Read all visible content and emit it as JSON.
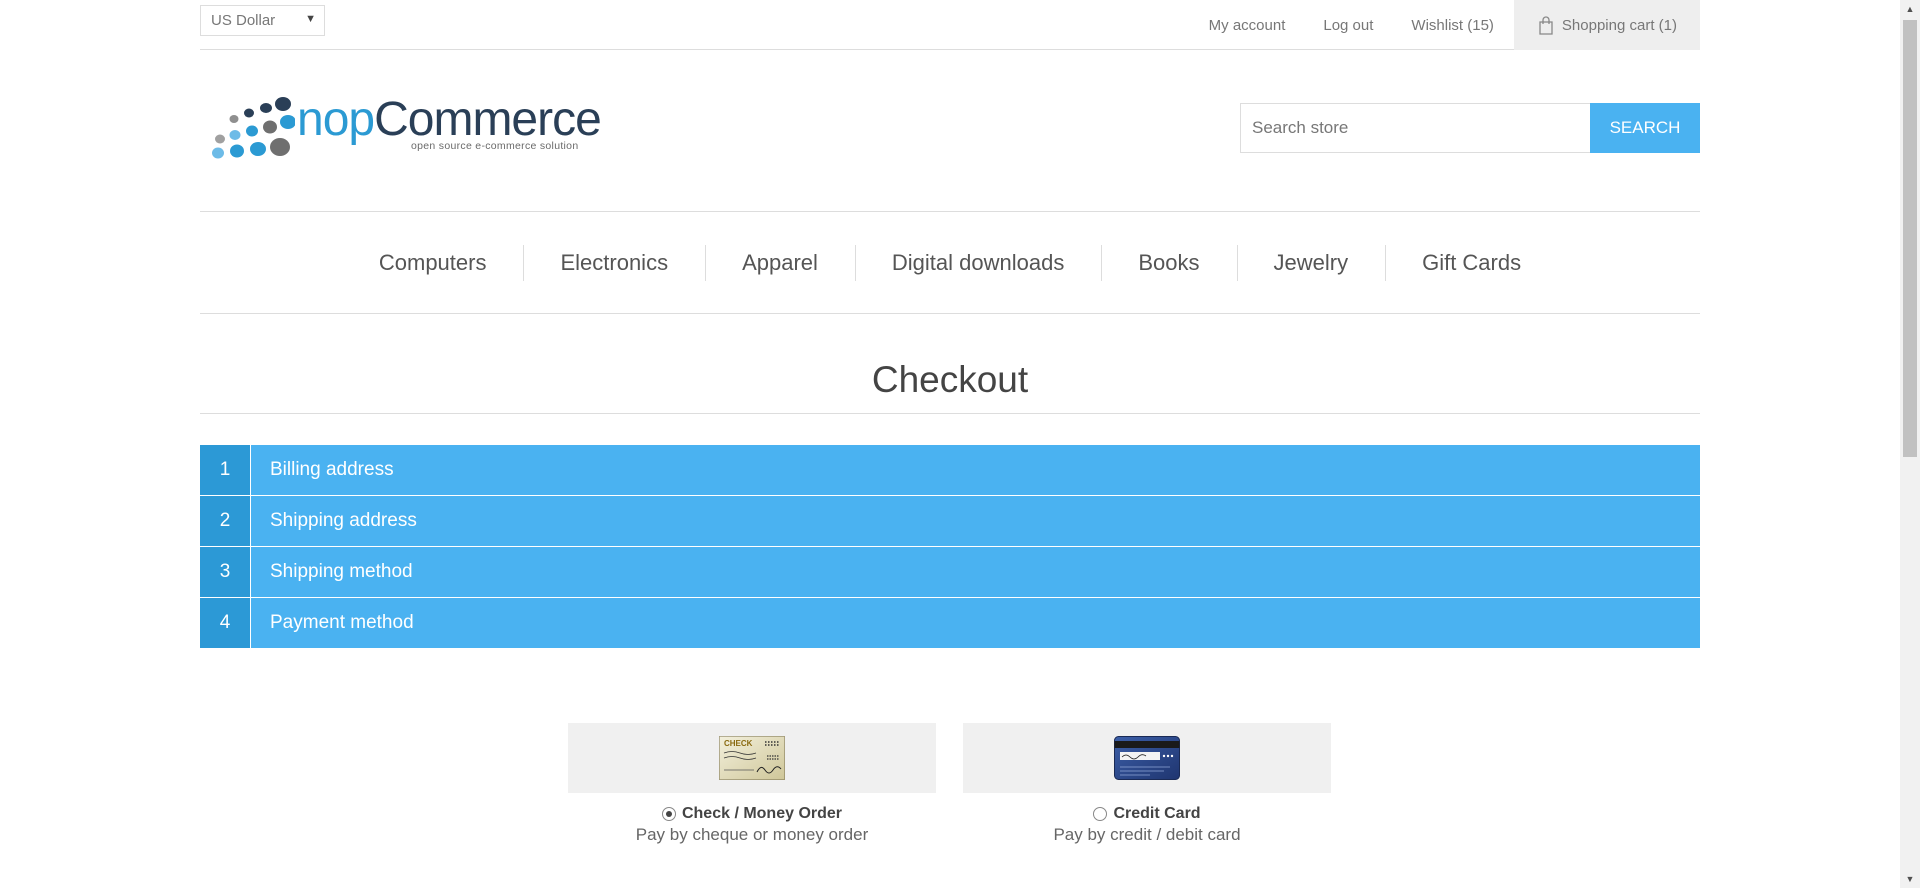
{
  "header": {
    "currency": "US Dollar",
    "links": {
      "my_account": "My account",
      "log_out": "Log out",
      "wishlist": "Wishlist (15)",
      "cart": "Shopping cart (1)"
    }
  },
  "logo": {
    "word_light": "nop",
    "word_dark": "Commerce",
    "tagline": "open source e-commerce solution"
  },
  "search": {
    "placeholder": "Search store",
    "button": "Search"
  },
  "menu": [
    "Computers",
    "Electronics",
    "Apparel",
    "Digital downloads",
    "Books",
    "Jewelry",
    "Gift Cards"
  ],
  "page": {
    "title": "Checkout"
  },
  "steps": [
    {
      "num": "1",
      "title": "Billing address"
    },
    {
      "num": "2",
      "title": "Shipping address"
    },
    {
      "num": "3",
      "title": "Shipping method"
    },
    {
      "num": "4",
      "title": "Payment method"
    }
  ],
  "payment_methods": [
    {
      "name": "Check / Money Order",
      "description": "Pay by cheque or money order",
      "selected": true,
      "image_text": "CHECK"
    },
    {
      "name": "Credit Card",
      "description": "Pay by credit / debit card",
      "selected": false,
      "image_text": ""
    }
  ],
  "colors": {
    "accent": "#4ab2f1",
    "accent_dark": "#2c99d6"
  }
}
